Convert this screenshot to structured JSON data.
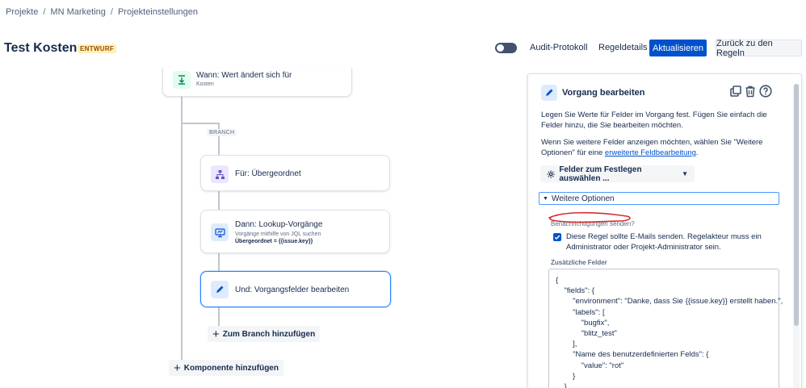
{
  "breadcrumb": [
    "Projekte",
    "MN Marketing",
    "Projekteinstellungen"
  ],
  "breadcrumb_sep": "/",
  "header": {
    "title": "Test Kosten",
    "badge": "ENTWURF",
    "audit": "Audit-Protokoll",
    "details": "Regeldetails",
    "update": "Aktualisieren",
    "back": "Zurück zu den Regeln"
  },
  "flow": {
    "trigger": {
      "title": "Wann: Wert ändert sich für",
      "sub": "Kosten"
    },
    "branch_label": "BRANCH",
    "parent": {
      "title": "Für: Übergeordnet"
    },
    "lookup": {
      "title": "Dann: Lookup-Vorgänge",
      "sub": "Vorgänge mithilfe von JQL suchen",
      "sub2": "Übergeordnet = {{issue.key}}"
    },
    "edit": {
      "title": "Und: Vorgangsfelder bearbeiten"
    },
    "add_branch": "Zum Branch hinzufügen",
    "add_component": "Komponente hinzufügen"
  },
  "panel": {
    "title": "Vorgang bearbeiten",
    "desc1": "Legen Sie Werte für Felder im Vorgang fest. Fügen Sie einfach die Felder hinzu, die Sie bearbeiten möchten.",
    "desc2_pre": "Wenn Sie weitere Felder anzeigen möchten, wählen Sie \"Weitere Optionen\" für eine ",
    "desc2_link": "erweiterte Feldbearbeitung",
    "desc2_post": ".",
    "field_select": "Felder zum Festlegen auswählen ...",
    "more_options": "Weitere Optionen",
    "notify_label": "Benachrichtigungen senden?",
    "notify_text": "Diese Regel sollte E-Mails senden. Regelakteur muss ein Administrator oder Projekt-Administrator sein.",
    "extra_label": "Zusätzliche Felder",
    "json": "{\n    \"fields\": {\n        \"environment\": \"Danke, dass Sie {{issue.key}} erstellt haben.\",\n        \"labels\": [\n            \"bugfix\",\n            \"blitz_test\"\n        ],\n        \"Name des benutzerdefinierten Felds\": {\n            \"value\": \"rot\"\n        }\n    }"
  },
  "colors": {
    "primary": "#0052cc",
    "selected_border": "#2684ff",
    "annotation": "#d32f2f"
  }
}
